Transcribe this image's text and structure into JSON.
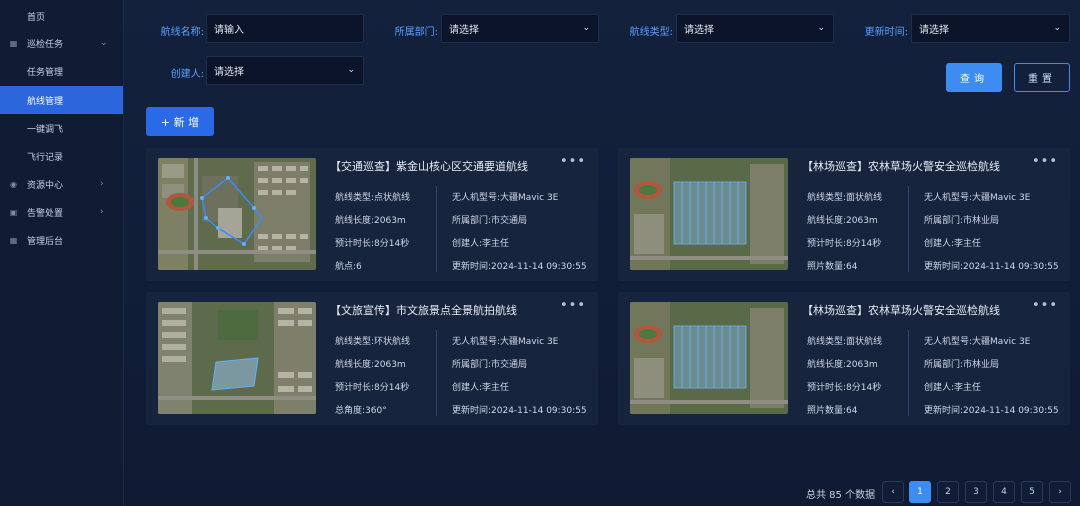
{
  "sidebar": {
    "items": [
      {
        "label": "首页",
        "icon": "",
        "chevron": ""
      },
      {
        "label": "巡检任务",
        "icon": "▦",
        "chevron": "⌄"
      },
      {
        "label": "任务管理",
        "icon": "",
        "chevron": ""
      },
      {
        "label": "航线管理",
        "icon": "",
        "chevron": ""
      },
      {
        "label": "一键调飞",
        "icon": "",
        "chevron": ""
      },
      {
        "label": "飞行记录",
        "icon": "",
        "chevron": ""
      },
      {
        "label": "资源中心",
        "icon": "◉",
        "chevron": "›"
      },
      {
        "label": "告警处置",
        "icon": "▣",
        "chevron": "›"
      },
      {
        "label": "管理后台",
        "icon": "▦",
        "chevron": ""
      }
    ]
  },
  "filters": {
    "route_name": {
      "label": "航线名称:",
      "placeholder": "请输入"
    },
    "department": {
      "label": "所属部门:",
      "value": "请选择"
    },
    "route_type": {
      "label": "航线类型:",
      "value": "请选择"
    },
    "update_time": {
      "label": "更新时间:",
      "value": "请选择"
    },
    "creator": {
      "label": "创建人:",
      "value": "请选择"
    },
    "caret": "⌄"
  },
  "buttons": {
    "query": "查询",
    "reset": "重置",
    "add": "+ 新 增",
    "more": "•••"
  },
  "cards": [
    {
      "title": "【交通巡查】紫金山核心区交通要道航线",
      "left": [
        "航线类型:点状航线",
        "航线长度:2063m",
        "预计时长:8分14秒",
        "航点:6"
      ],
      "right": [
        "无人机型号:大疆Mavic 3E",
        "所属部门:市交通局",
        "创建人:李主任",
        "更新时间:2024-11-14 09:30:55"
      ]
    },
    {
      "title": "【林场巡查】农林草场火警安全巡检航线",
      "left": [
        "航线类型:面状航线",
        "航线长度:2063m",
        "预计时长:8分14秒",
        "照片数量:64"
      ],
      "right": [
        "无人机型号:大疆Mavic 3E",
        "所属部门:市林业局",
        "创建人:李主任",
        "更新时间:2024-11-14 09:30:55"
      ]
    },
    {
      "title": "【文旅宣传】市文旅景点全景航拍航线",
      "left": [
        "航线类型:环状航线",
        "航线长度:2063m",
        "预计时长:8分14秒",
        "总角度:360°"
      ],
      "right": [
        "无人机型号:大疆Mavic 3E",
        "所属部门:市交通局",
        "创建人:李主任",
        "更新时间:2024-11-14 09:30:55"
      ]
    },
    {
      "title": "【林场巡查】农林草场火警安全巡检航线",
      "left": [
        "航线类型:面状航线",
        "航线长度:2063m",
        "预计时长:8分14秒",
        "照片数量:64"
      ],
      "right": [
        "无人机型号:大疆Mavic 3E",
        "所属部门:市林业局",
        "创建人:李主任",
        "更新时间:2024-11-14 09:30:55"
      ]
    }
  ],
  "pagination": {
    "total": "总共 85 个数据",
    "prev": "‹",
    "next": "›",
    "pages": [
      "1",
      "2",
      "3",
      "4",
      "5"
    ],
    "current": "1"
  },
  "colors": {
    "accent": "#3c8cf2",
    "sidebar_active": "#2b66dc",
    "label": "#5aa0ff"
  }
}
